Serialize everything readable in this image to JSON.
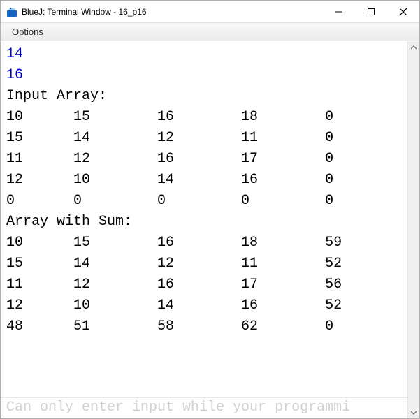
{
  "window": {
    "title": "BlueJ: Terminal Window - 16_p16"
  },
  "menu": {
    "options": "Options"
  },
  "terminal": {
    "user_inputs": [
      "14",
      "16"
    ],
    "label_input": "Input Array:",
    "input_array": [
      [
        "10",
        "15",
        "16",
        "18",
        "0"
      ],
      [
        "15",
        "14",
        "12",
        "11",
        "0"
      ],
      [
        "11",
        "12",
        "16",
        "17",
        "0"
      ],
      [
        "12",
        "10",
        "14",
        "16",
        "0"
      ],
      [
        "0",
        "0",
        "0",
        "0",
        "0"
      ]
    ],
    "label_sum": "Array with Sum:",
    "sum_array": [
      [
        "10",
        "15",
        "16",
        "18",
        "59"
      ],
      [
        "15",
        "14",
        "12",
        "11",
        "52"
      ],
      [
        "11",
        "12",
        "16",
        "17",
        "56"
      ],
      [
        "12",
        "10",
        "14",
        "16",
        "52"
      ],
      [
        "48",
        "51",
        "58",
        "62",
        "0"
      ]
    ]
  },
  "status": {
    "hint": "Can only enter input while your programmi"
  }
}
